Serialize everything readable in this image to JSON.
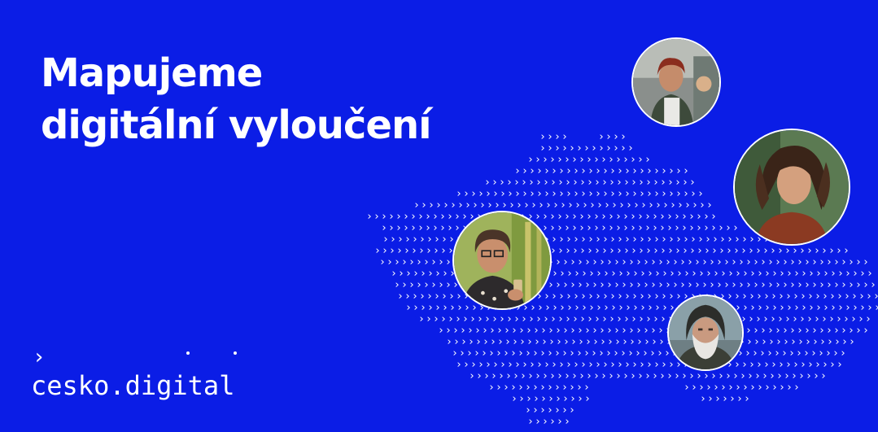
{
  "headline": {
    "line1": "Mapujeme",
    "line2": "digitální vyloučení"
  },
  "logo": {
    "chevron": "›",
    "text": "cesko.digital"
  },
  "map": {
    "glyph": "›",
    "color": "#ffffff",
    "background": "#0b1de6"
  },
  "photos": [
    {
      "icon": "older-woman-street-portrait"
    },
    {
      "icon": "young-woman-curly-hair-portrait"
    },
    {
      "icon": "smiling-senior-woman-phone-portrait"
    },
    {
      "icon": "bearded-man-hood-portrait"
    }
  ]
}
